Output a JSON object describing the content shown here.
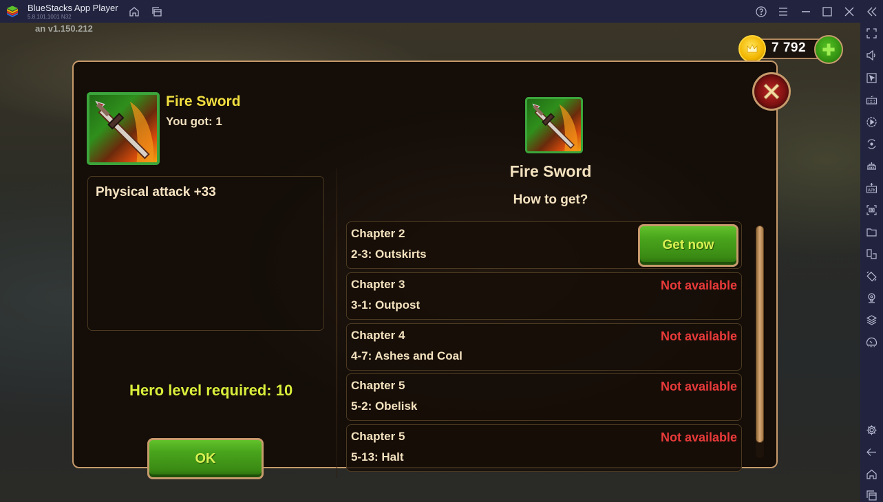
{
  "window": {
    "app_title": "BlueStacks App Player",
    "app_version": "5.8.101.1001  N32",
    "title_icons": [
      "home-icon",
      "multi-instance-icon"
    ],
    "controls": [
      "help-icon",
      "menu-icon",
      "minimize-icon",
      "maximize-icon",
      "close-icon",
      "collapse-sidebar-icon"
    ]
  },
  "sidebar": {
    "items": [
      {
        "name": "fullscreen-icon"
      },
      {
        "name": "volume-icon"
      },
      {
        "name": "pointer-icon"
      },
      {
        "name": "keyboard-icon"
      },
      {
        "name": "macro-record-icon"
      },
      {
        "name": "sync-icon"
      },
      {
        "name": "game-controls-icon"
      },
      {
        "name": "apk-install-icon"
      },
      {
        "name": "screenshot-icon"
      },
      {
        "name": "folder-icon"
      },
      {
        "name": "multi-instance-icon"
      },
      {
        "name": "rotate-icon"
      },
      {
        "name": "location-icon"
      },
      {
        "name": "layers-icon"
      },
      {
        "name": "eco-mode-icon"
      },
      {
        "name": "settings-icon"
      },
      {
        "name": "back-icon"
      },
      {
        "name": "home-icon"
      },
      {
        "name": "recent-apps-icon"
      }
    ]
  },
  "game": {
    "version_label": "an v1.150.212",
    "currency": {
      "icon": "crown-coin-icon",
      "value": "7 792",
      "add_icon": "plus-icon"
    },
    "dialog": {
      "item_name": "Fire Sword",
      "owned_label": "You got:  1",
      "stat": "Physical attack +33",
      "hero_level_label": "Hero level required:  10",
      "ok_label": "OK",
      "right_title": "Fire Sword",
      "how_to_get": "How to get?",
      "sources": [
        {
          "chapter": "Chapter 2",
          "stage": "2-3: Outskirts",
          "action": "Get now",
          "available": true
        },
        {
          "chapter": "Chapter 3",
          "stage": "3-1: Outpost",
          "status": "Not available",
          "available": false
        },
        {
          "chapter": "Chapter 4",
          "stage": "4-7: Ashes and Coal",
          "status": "Not available",
          "available": false
        },
        {
          "chapter": "Chapter 5",
          "stage": "5-2: Obelisk",
          "status": "Not available",
          "available": false
        },
        {
          "chapter": "Chapter 5",
          "stage": "5-13: Halt",
          "status": "Not available",
          "available": false
        }
      ],
      "scroll_position": 0.0,
      "colors": {
        "title_yellow": "#f2df40",
        "level_green": "#d9ee3b",
        "unavailable_red": "#e93a3a",
        "frame_tan": "#c69a6b"
      }
    }
  }
}
